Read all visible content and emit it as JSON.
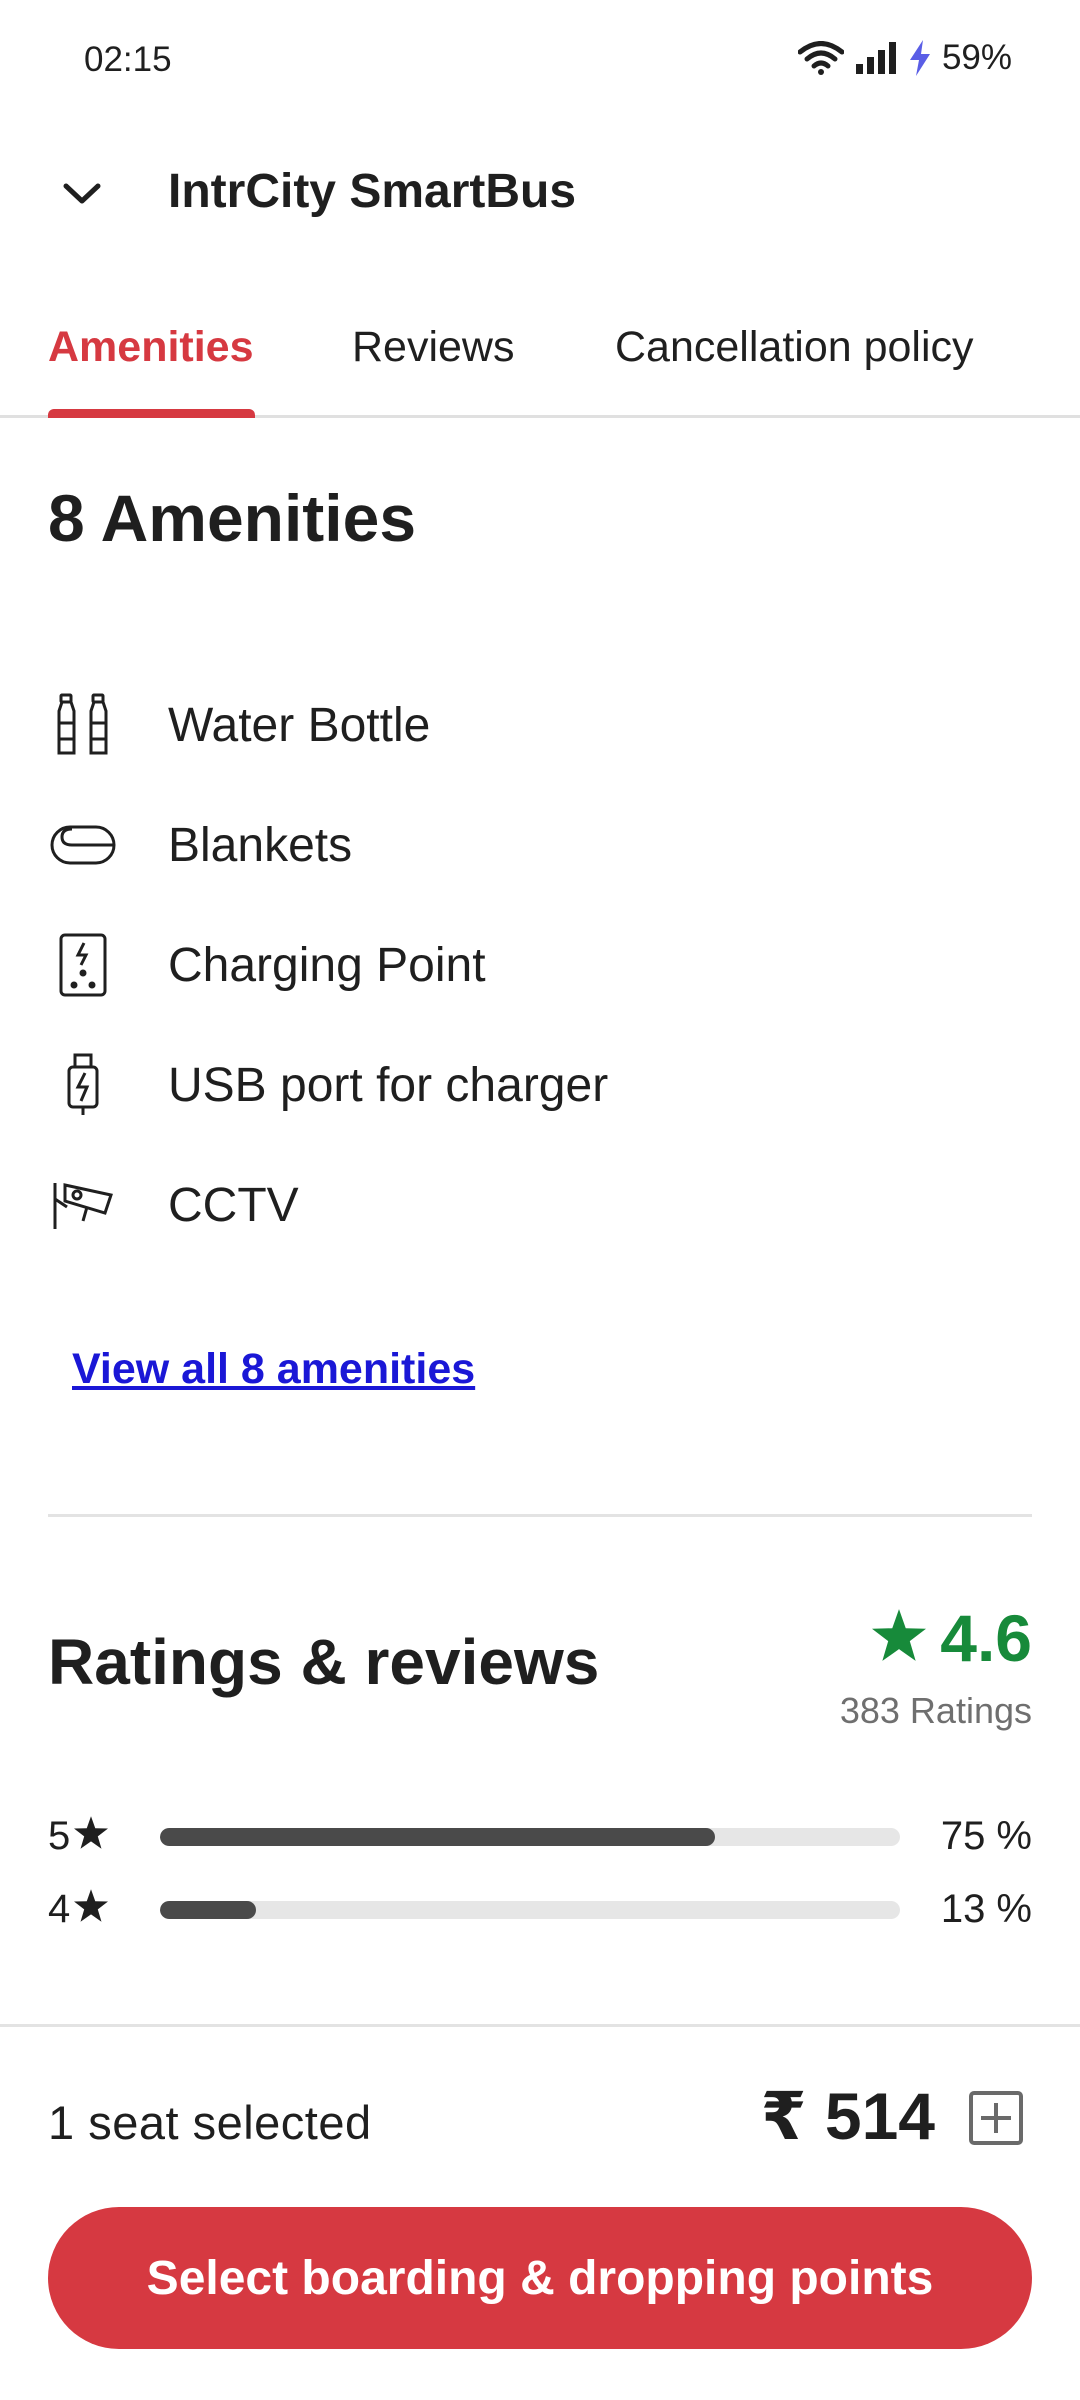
{
  "status_bar": {
    "time": "02:15",
    "battery": "59%",
    "icons": [
      "wifi-icon",
      "signal-icon",
      "charging-icon"
    ]
  },
  "header": {
    "title": "IntrCity SmartBus",
    "back_icon": "chevron-down-icon"
  },
  "tabs": [
    {
      "label": "Amenities",
      "active": true
    },
    {
      "label": "Reviews",
      "active": false
    },
    {
      "label": "Cancellation policy",
      "active": false
    }
  ],
  "amenities": {
    "title": "8 Amenities",
    "items": [
      {
        "label": "Water Bottle",
        "icon": "water-bottle-icon"
      },
      {
        "label": "Blankets",
        "icon": "blanket-icon"
      },
      {
        "label": "Charging Point",
        "icon": "charging-point-icon"
      },
      {
        "label": "USB port for charger",
        "icon": "usb-icon"
      },
      {
        "label": "CCTV",
        "icon": "cctv-icon"
      }
    ],
    "view_all": "View all 8 amenities"
  },
  "ratings": {
    "title": "Ratings & reviews",
    "score": "4.6",
    "count": "383 Ratings",
    "bars": [
      {
        "stars": "5",
        "percent": "75 %",
        "fraction": 0.75
      },
      {
        "stars": "4",
        "percent": "13 %",
        "fraction": 0.13
      }
    ]
  },
  "footer": {
    "seats": "1 seat selected",
    "price": "₹ 514",
    "cta": "Select boarding & dropping points"
  },
  "colors": {
    "accent": "#d63941",
    "rating_green": "#178a3a",
    "link": "#1a17d6"
  }
}
